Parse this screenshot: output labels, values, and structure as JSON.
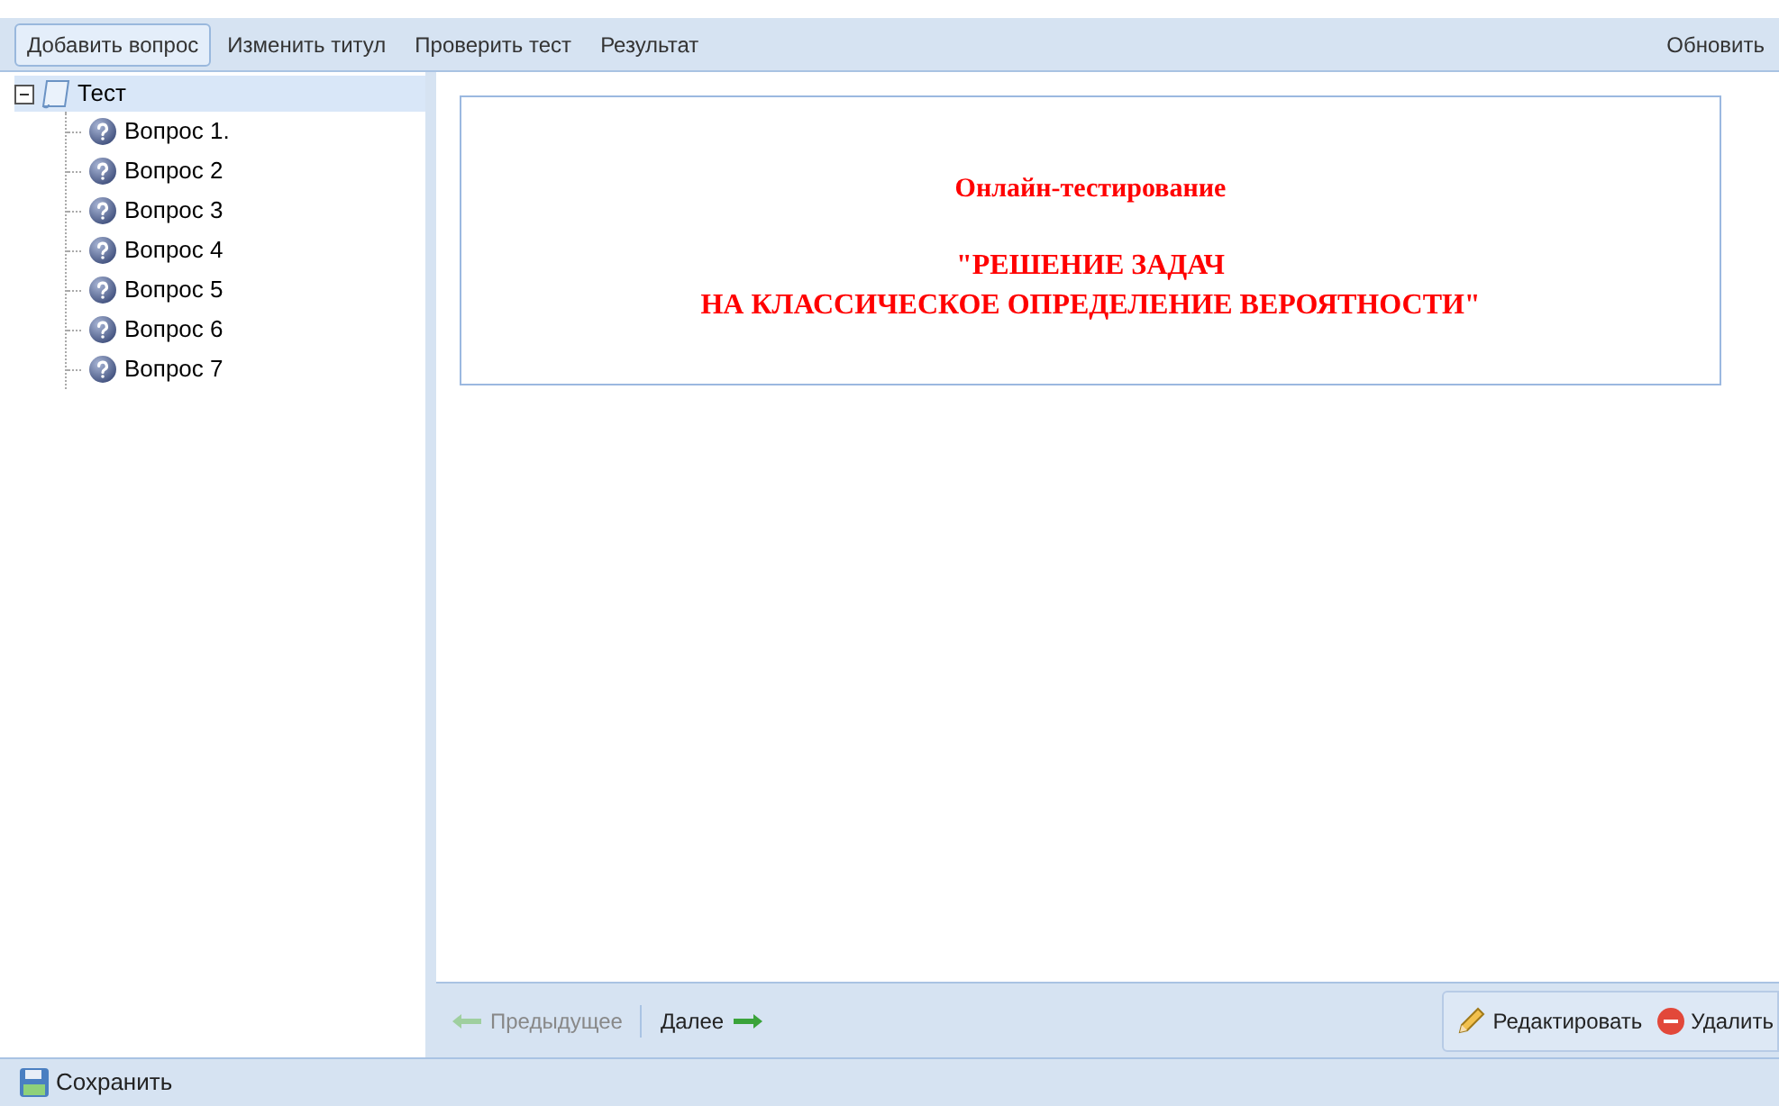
{
  "toolbar": {
    "buttons": [
      {
        "label": "Добавить вопрос",
        "selected": true
      },
      {
        "label": "Изменить титул",
        "selected": false
      },
      {
        "label": "Проверить тест",
        "selected": false
      },
      {
        "label": "Результат",
        "selected": false
      }
    ],
    "refresh": "Обновить"
  },
  "tree": {
    "label": "Тест",
    "expanded": true,
    "selected": true,
    "children": [
      {
        "label": "Вопрос 1.",
        "selected": false
      },
      {
        "label": "Вопрос 2",
        "selected": false
      },
      {
        "label": "Вопрос 3",
        "selected": false
      },
      {
        "label": "Вопрос 4",
        "selected": false
      },
      {
        "label": "Вопрос 5",
        "selected": false
      },
      {
        "label": "Вопрос 6",
        "selected": false
      },
      {
        "label": "Вопрос 7",
        "selected": false
      }
    ]
  },
  "title_card": {
    "subtitle": "Онлайн-тестирование",
    "title_lines": [
      "\"РЕШЕНИЕ ЗАДАЧ",
      "НА КЛАССИЧЕСКОЕ ОПРЕДЕЛЕНИЕ ВЕРОЯТНОСТИ\""
    ]
  },
  "nav": {
    "previous": {
      "label": "Предыдущее",
      "disabled": true
    },
    "next": {
      "label": "Далее",
      "disabled": false
    }
  },
  "actions": {
    "edit": "Редактировать",
    "delete": "Удалить"
  },
  "footer": {
    "save": "Сохранить"
  }
}
